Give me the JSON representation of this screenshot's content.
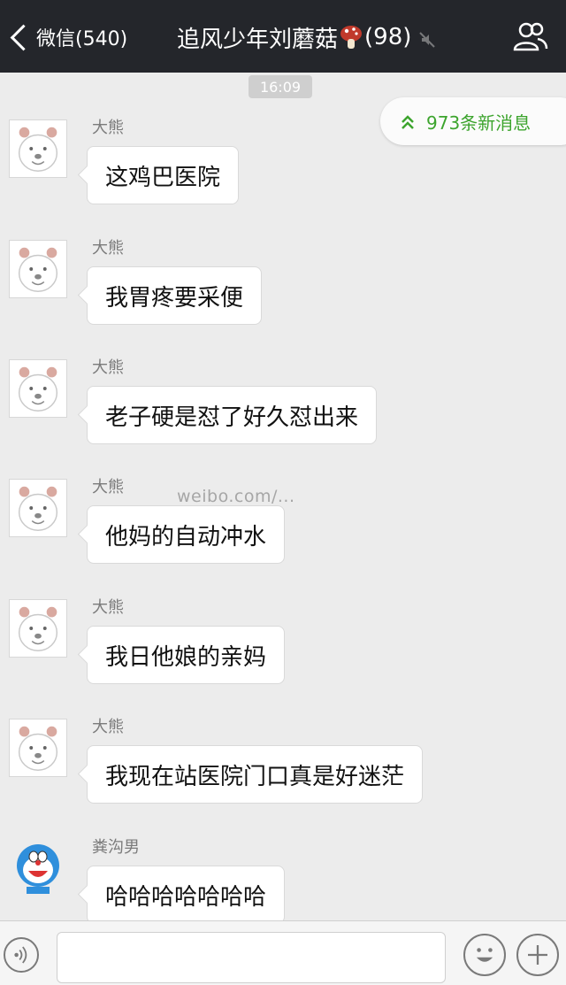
{
  "header": {
    "back_label": "微信(540)",
    "chat_title_prefix": "追风少年刘蘑菇",
    "chat_title_count": "(98)",
    "title_emoji": "mushroom-icon",
    "mute_icon": "mute-icon",
    "members_icon": "members-icon"
  },
  "time_label": "16:09",
  "new_messages": {
    "label": "973条新消息",
    "icon": "double-chevron-up-icon"
  },
  "messages": [
    {
      "sender": "大熊",
      "text": "这鸡巴医院",
      "avatar": "bear-avatar"
    },
    {
      "sender": "大熊",
      "text": "我胃疼要采便",
      "avatar": "bear-avatar"
    },
    {
      "sender": "大熊",
      "text": "老子硬是怼了好久怼出来",
      "avatar": "bear-avatar"
    },
    {
      "sender": "大熊",
      "text": "他妈的自动冲水",
      "avatar": "bear-avatar"
    },
    {
      "sender": "大熊",
      "text": "我日他娘的亲妈",
      "avatar": "bear-avatar"
    },
    {
      "sender": "大熊",
      "text": "我现在站医院门口真是好迷茫",
      "avatar": "bear-avatar"
    },
    {
      "sender": "粪沟男",
      "text": "哈哈哈哈哈哈哈",
      "avatar": "doraemon-avatar"
    }
  ],
  "watermark": "weibo.com/...",
  "input_bar": {
    "voice_icon": "voice-icon",
    "input_value": "",
    "emoji_icon": "emoji-icon",
    "plus_icon": "plus-icon"
  },
  "colors": {
    "header_bg": "#24262b",
    "chat_bg": "#ececec",
    "accent_green": "#3ca42d"
  }
}
